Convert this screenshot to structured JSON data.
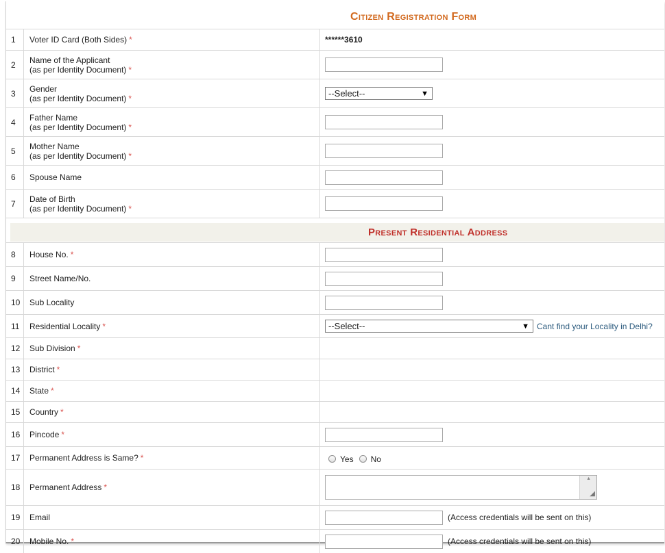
{
  "form": {
    "title": "Citizen Registration Form",
    "section_address": "Present Residential Address",
    "required_mark": "*"
  },
  "rows": [
    {
      "num": "1",
      "label": "Voter ID Card (Both Sides)",
      "sub": "",
      "required": true,
      "value": "******3610"
    },
    {
      "num": "2",
      "label": "Name of the Applicant",
      "sub": "(as per Identity Document)",
      "required": true
    },
    {
      "num": "3",
      "label": "Gender",
      "sub": "(as per Identity Document)",
      "required": true,
      "select": "--Select--"
    },
    {
      "num": "4",
      "label": "Father Name",
      "sub": "(as per Identity Document)",
      "required": true
    },
    {
      "num": "5",
      "label": "Mother Name",
      "sub": "(as per Identity Document)",
      "required": true
    },
    {
      "num": "6",
      "label": "Spouse Name",
      "sub": "",
      "required": false
    },
    {
      "num": "7",
      "label": "Date of Birth",
      "sub": "(as per Identity Document)",
      "required": true
    },
    {
      "num": "8",
      "label": "House No.",
      "required": true
    },
    {
      "num": "9",
      "label": "Street Name/No.",
      "required": false
    },
    {
      "num": "10",
      "label": "Sub Locality",
      "required": false
    },
    {
      "num": "11",
      "label": "Residential Locality",
      "required": true,
      "select": "--Select--",
      "link": "Cant find your Locality in Delhi?"
    },
    {
      "num": "12",
      "label": "Sub Division",
      "required": true
    },
    {
      "num": "13",
      "label": "District",
      "required": true
    },
    {
      "num": "14",
      "label": "State",
      "required": true
    },
    {
      "num": "15",
      "label": "Country",
      "required": true
    },
    {
      "num": "16",
      "label": "Pincode",
      "required": true
    },
    {
      "num": "17",
      "label": "Permanent Address is Same?",
      "required": true,
      "options": [
        "Yes",
        "No"
      ]
    },
    {
      "num": "18",
      "label": "Permanent Address",
      "required": true
    },
    {
      "num": "19",
      "label": "Email",
      "required": false,
      "hint": "(Access credentials will be sent on this)"
    },
    {
      "num": "20",
      "label": "Mobile No.",
      "required": true,
      "hint": "(Access credentials will be sent on this)"
    }
  ],
  "icons": {
    "dropdown": "triangle-down-icon",
    "radio": "radio-icon",
    "resize": "resize-grip-icon"
  }
}
